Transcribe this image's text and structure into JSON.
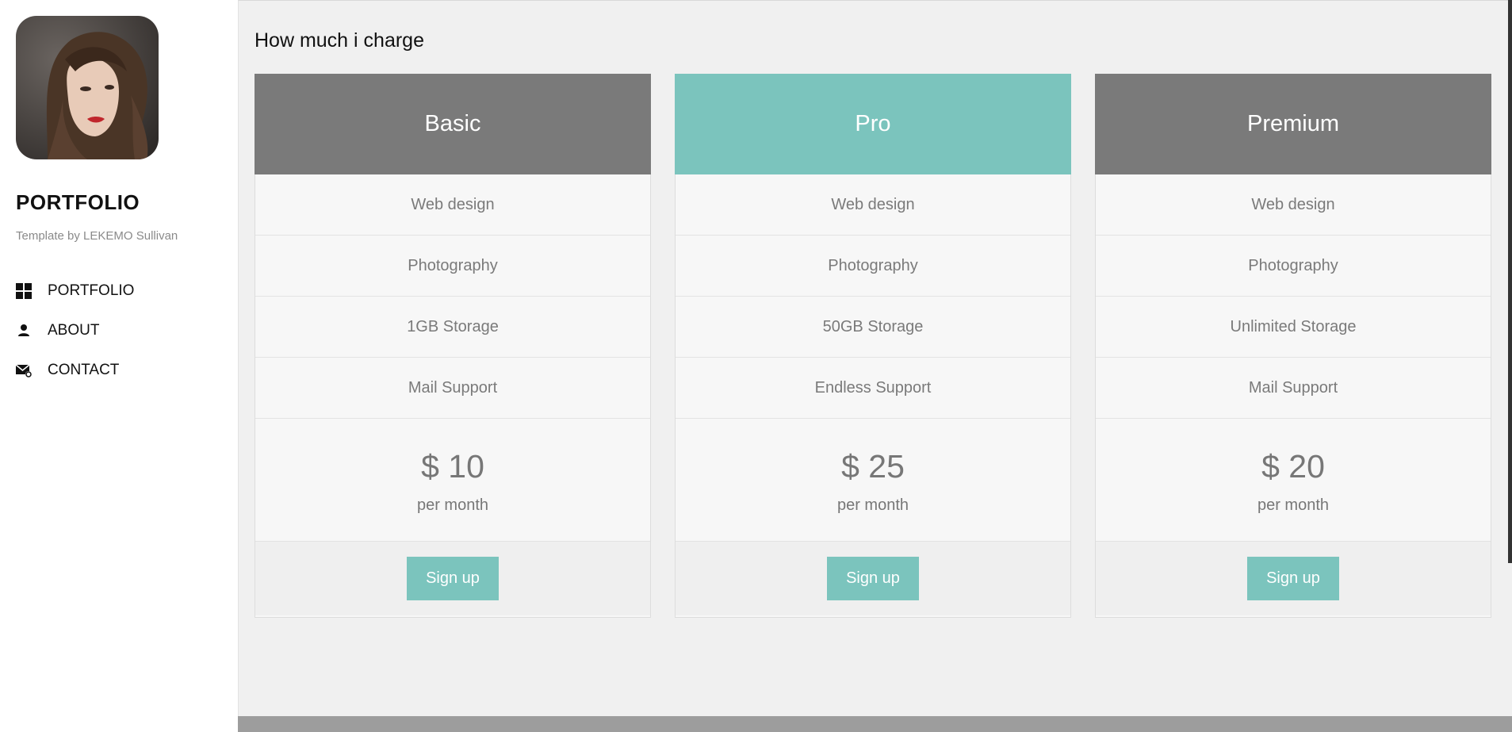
{
  "sidebar": {
    "title": "PORTFOLIO",
    "byline": "Template by LEKEMO Sullivan",
    "nav": [
      {
        "label": "PORTFOLIO",
        "icon": "grid-icon"
      },
      {
        "label": "ABOUT",
        "icon": "person-icon"
      },
      {
        "label": "CONTACT",
        "icon": "mail-icon"
      }
    ]
  },
  "pricing": {
    "title": "How much i charge",
    "plans": [
      {
        "name": "Basic",
        "features": [
          "Web design",
          "Photography",
          "1GB Storage",
          "Mail Support"
        ],
        "price": "$ 10",
        "period": "per month",
        "cta": "Sign up",
        "header_color": "#7a7a7a"
      },
      {
        "name": "Pro",
        "features": [
          "Web design",
          "Photography",
          "50GB Storage",
          "Endless Support"
        ],
        "price": "$ 25",
        "period": "per month",
        "cta": "Sign up",
        "header_color": "#7bc4bd"
      },
      {
        "name": "Premium",
        "features": [
          "Web design",
          "Photography",
          "Unlimited Storage",
          "Mail Support"
        ],
        "price": "$ 20",
        "period": "per month",
        "cta": "Sign up",
        "header_color": "#7a7a7a"
      }
    ]
  },
  "colors": {
    "accent": "#7bc4bd",
    "plan_header_grey": "#7a7a7a",
    "background": "#f0f0f0"
  }
}
